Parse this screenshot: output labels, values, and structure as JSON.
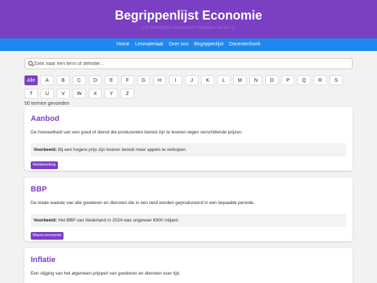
{
  "header": {
    "title": "Begrippenlijst Economie",
    "subtitle": "Alle belangrijke economische begrippen op een rij"
  },
  "nav": [
    "Home",
    "Lesmateriaal",
    "Over ons",
    "Begrippenlijst",
    "Docentenhoek"
  ],
  "search": {
    "placeholder": "Zoek naar een term of definitie..."
  },
  "letters": [
    "Alle",
    "A",
    "B",
    "C",
    "D",
    "E",
    "F",
    "G",
    "H",
    "I",
    "J",
    "K",
    "L",
    "M",
    "N",
    "O",
    "P",
    "Q",
    "R",
    "S",
    "T",
    "U",
    "V",
    "W",
    "X",
    "Y",
    "Z"
  ],
  "active_letter": "Alle",
  "count": "50 termen gevonden",
  "terms": [
    {
      "title": "Aanbod",
      "definition": "De hoeveelheid van een goed of dienst die producenten bereid zijn te leveren tegen verschillende prijzen.",
      "example_label": "Voorbeeld:",
      "example": "Bij een hogere prijs zijn boeren bereid meer appels te verkopen.",
      "tag": "Marktwerking"
    },
    {
      "title": "BBP",
      "definition": "De totale waarde van alle goederen en diensten die in een land worden geproduceerd in een bepaalde periode.",
      "example_label": "Voorbeeld:",
      "example": "Het BBP van Nederland in 2024 was ongeveer €900 miljard.",
      "tag": "Macro-economie"
    },
    {
      "title": "Inflatie",
      "definition": "Een stijging van het algemeen prijspeil van goederen en diensten over tijd."
    }
  ],
  "colors": {
    "primary": "#7b3fc4",
    "nav": "#1e88ef",
    "background": "#f2f2f2"
  }
}
